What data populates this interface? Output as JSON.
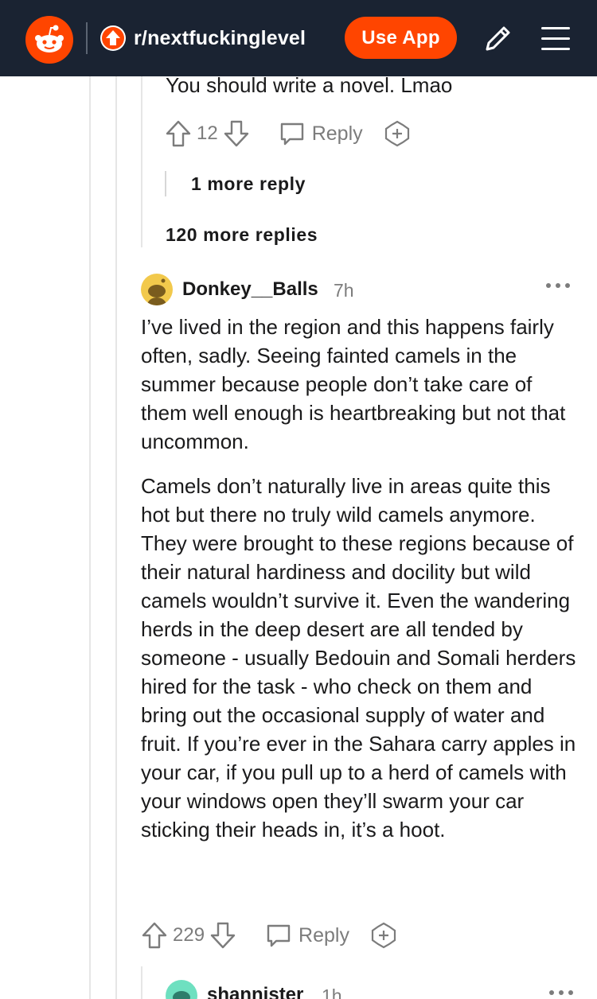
{
  "header": {
    "logo_icon": "reddit-snoo-icon",
    "subreddit_icon": "upvote-arrow-icon",
    "subreddit": "r/nextfuckinglevel",
    "use_app_label": "Use App",
    "edit_icon": "pencil-icon",
    "menu_icon": "hamburger-menu-icon",
    "colors": {
      "bar": "#1a2332",
      "accent": "#ff4500"
    }
  },
  "previous_comment": {
    "text": "You should write a novel. Lmao",
    "score": "12",
    "reply_label": "Reply",
    "more_reply": "1 more reply"
  },
  "more_replies": "120 more replies",
  "comment": {
    "username": "Donkey__Balls",
    "time": "7h",
    "paragraphs": [
      "I’ve lived in the region and this happens fairly often, sadly. Seeing fainted camels in the summer because people don’t take care of them well enough is heartbreaking but not that uncommon.",
      "Camels don’t naturally live in areas quite this hot but there no truly wild camels anymore. They were brought to these regions because of their natural hardiness and docility but wild camels wouldn’t survive it. Even the wandering herds in the deep desert are all tended by someone - usually Bedouin and Somali herders hired for the task - who check on them and bring out the occasional supply of water and fruit. If you’re ever in the Sahara carry apples in your car, if you pull up to a herd of camels with your windows open they’ll swarm your car sticking their heads in, it’s a hoot."
    ],
    "score": "229",
    "reply_label": "Reply"
  },
  "next_comment": {
    "username": "shannister",
    "time": "1h"
  }
}
